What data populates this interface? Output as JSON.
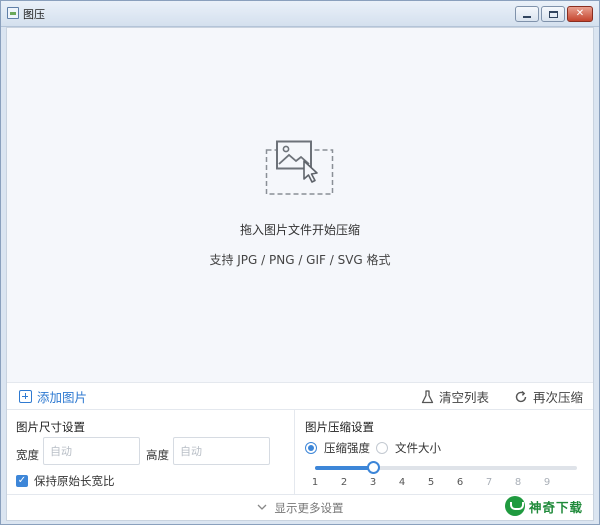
{
  "window": {
    "title": "图压"
  },
  "dropzone": {
    "main_text": "拖入图片文件开始压缩",
    "sub_text": "支持 JPG / PNG / GIF / SVG 格式",
    "icon": "image-drop-icon"
  },
  "toolbar": {
    "add_label": "添加图片",
    "clear_label": "清空列表",
    "again_label": "再次压缩"
  },
  "size_settings": {
    "title": "图片尺寸设置",
    "width_label": "宽度",
    "width_placeholder": "自动",
    "height_label": "高度",
    "height_placeholder": "自动",
    "keep_ratio_label": "保持原始长宽比",
    "keep_ratio_checked": true
  },
  "compress_settings": {
    "title": "图片压缩设置",
    "mode_strength_label": "压缩强度",
    "mode_size_label": "文件大小",
    "selected_mode": "压缩强度",
    "strength_level": 3,
    "ticks": [
      "1",
      "2",
      "3",
      "4",
      "5",
      "6",
      "7",
      "8",
      "9"
    ]
  },
  "footer": {
    "more_label": "显示更多设置"
  },
  "watermark": {
    "text": "神奇下载"
  },
  "colors": {
    "accent": "#3d86d8",
    "link": "#2f7ad1"
  }
}
